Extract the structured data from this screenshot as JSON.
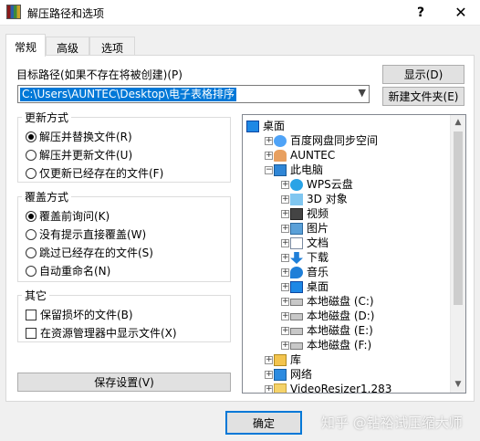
{
  "window": {
    "title": "解压路径和选项",
    "help_label": "?",
    "close_label": "✕"
  },
  "tabs": [
    "常规",
    "高级",
    "选项"
  ],
  "destination": {
    "label": "目标路径(如果不存在将被创建)(P)",
    "value": "C:\\Users\\AUNTEC\\Desktop\\电子表格排序",
    "show_button": "显示(D)",
    "new_folder_button": "新建文件夹(E)"
  },
  "update_mode": {
    "title": "更新方式",
    "options": [
      "解压并替换文件(R)",
      "解压并更新文件(U)",
      "仅更新已经存在的文件(F)"
    ],
    "selected_index": 0
  },
  "overwrite_mode": {
    "title": "覆盖方式",
    "options": [
      "覆盖前询问(K)",
      "没有提示直接覆盖(W)",
      "跳过已经存在的文件(S)",
      "自动重命名(N)"
    ],
    "selected_index": 0
  },
  "misc": {
    "title": "其它",
    "options": [
      "保留损坏的文件(B)",
      "在资源管理器中显示文件(X)"
    ]
  },
  "save_settings_button": "保存设置(V)",
  "tree": {
    "items": [
      {
        "label": "桌面",
        "icon": "desktop-icon",
        "toggle": ""
      },
      {
        "label": "百度网盘同步空间",
        "icon": "baidu-sync-icon",
        "toggle": "+"
      },
      {
        "label": "AUNTEC",
        "icon": "user-icon",
        "toggle": "+"
      },
      {
        "label": "此电脑",
        "icon": "computer-icon",
        "toggle": "−"
      },
      {
        "label": "WPS云盘",
        "icon": "wps-cloud-icon",
        "toggle": "+"
      },
      {
        "label": "3D 对象",
        "icon": "3d-objects-icon",
        "toggle": "+"
      },
      {
        "label": "视频",
        "icon": "video-icon",
        "toggle": "+"
      },
      {
        "label": "图片",
        "icon": "pictures-icon",
        "toggle": "+"
      },
      {
        "label": "文档",
        "icon": "documents-icon",
        "toggle": "+"
      },
      {
        "label": "下载",
        "icon": "download-icon",
        "toggle": "+"
      },
      {
        "label": "音乐",
        "icon": "music-icon",
        "toggle": "+"
      },
      {
        "label": "桌面",
        "icon": "desktop-icon",
        "toggle": "+"
      },
      {
        "label": "本地磁盘 (C:)",
        "icon": "drive-icon",
        "toggle": "+"
      },
      {
        "label": "本地磁盘 (D:)",
        "icon": "drive-icon",
        "toggle": "+"
      },
      {
        "label": "本地磁盘 (E:)",
        "icon": "drive-icon",
        "toggle": "+"
      },
      {
        "label": "本地磁盘 (F:)",
        "icon": "drive-icon",
        "toggle": "+"
      },
      {
        "label": "库",
        "icon": "library-icon",
        "toggle": "+"
      },
      {
        "label": "网络",
        "icon": "network-icon",
        "toggle": "+"
      },
      {
        "label": "VideoResizer1.283",
        "icon": "folder-icon",
        "toggle": "+"
      }
    ]
  },
  "footer": {
    "ok_button": "确定",
    "watermark": "知乎 @钻裕试压缩大师"
  },
  "colors": {
    "selection": "#0078d7",
    "button_face": "#e1e1e1",
    "panel": "#ffffff",
    "window_bg": "#f0f0f0"
  }
}
